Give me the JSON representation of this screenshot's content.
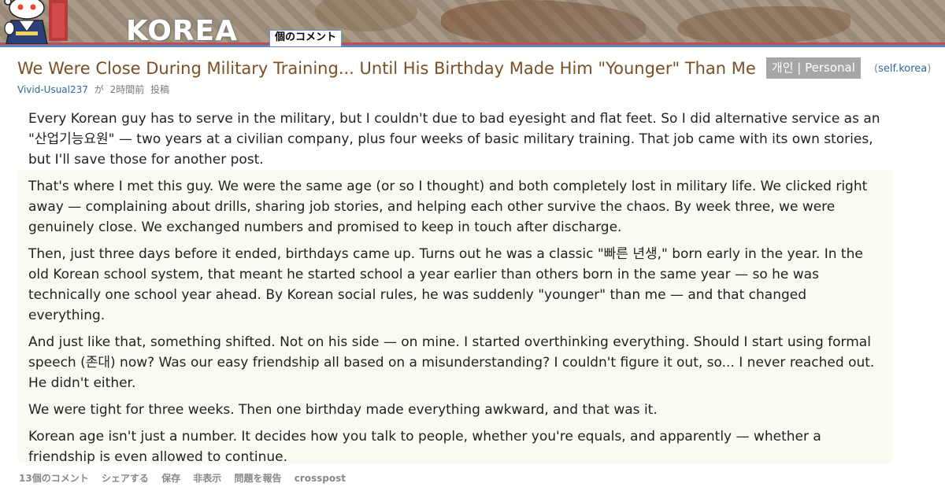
{
  "header": {
    "subreddit_title": "KOREA",
    "active_tab": "個のコメント",
    "mascot_icon": "reddit-alien-hanbok-icon"
  },
  "post": {
    "title": "We Were Close During Military Training... Until His Birthday Made Him \"Younger\" Than Me",
    "flair": "개인 | Personal",
    "domain_open": "(",
    "domain": "self.korea",
    "domain_close": ")",
    "author": "Vivid-Usual237",
    "by_word": "が",
    "time": "2時間前",
    "posted_word": "投稿",
    "paragraphs": [
      "Every Korean guy has to serve in the military, but I couldn't due to bad eyesight and flat feet. So I did alternative service as an \"산업기능요원\" — two years at a civilian company, plus four weeks of basic military training. That job came with its own stories, but I'll save those for another post.",
      "That's where I met this guy. We were the same age (or so I thought) and both completely lost in military life. We clicked right away — complaining about drills, sharing job stories, and helping each other survive the chaos. By week three, we were genuinely close. We exchanged numbers and promised to keep in touch after discharge.",
      "Then, just three days before it ended, birthdays came up. Turns out he was a classic \"빠른 년생,\" born early in the year. In the old Korean school system, that meant he started school a year earlier than others born in the same year — so he was technically one school year ahead. By Korean social rules, he was suddenly \"younger\" than me — and that changed everything.",
      "And just like that, something shifted. Not on his side — on mine. I started overthinking everything. Should I start using formal speech (존대) now? Was our easy friendship all based on a misunderstanding? I couldn't figure it out, so... I never reached out. He didn't either.",
      "We were tight for three weeks. Then one birthday made everything awkward, and that was it.",
      "Korean age isn't just a number. It decides how you talk to people, whether you're equals, and apparently — whether a friendship is even allowed to continue."
    ]
  },
  "buttons": {
    "comments": "13個のコメント",
    "share": "シェアする",
    "save": "保存",
    "hide": "非表示",
    "report": "問題を報告",
    "crosspost": "crosspost"
  },
  "colors": {
    "title": "#7a4f24",
    "flair_bg": "#a6a6a6",
    "link": "#336699",
    "body_bg": "#fafaf2",
    "stripe_red": "#c84b4b",
    "stripe_blue": "#5c85c8"
  }
}
